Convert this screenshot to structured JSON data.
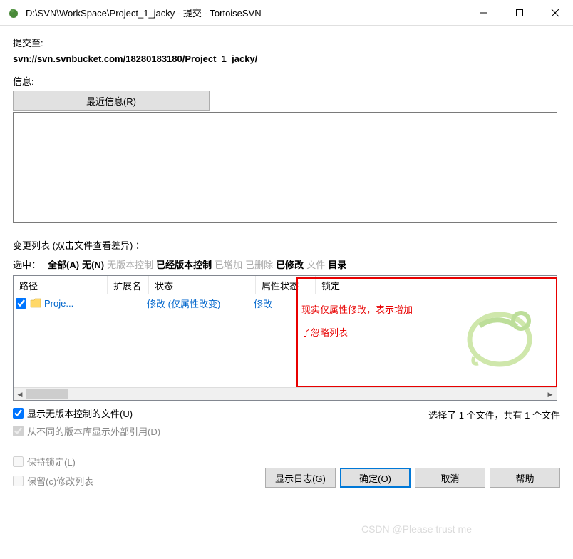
{
  "titlebar": {
    "icon": "tortoisesvn",
    "text": "D:\\SVN\\WorkSpace\\Project_1_jacky - 提交 - TortoiseSVN"
  },
  "commit_to": {
    "label": "提交至:",
    "url": "svn://svn.svnbucket.com/18280183180/Project_1_jacky/"
  },
  "info": {
    "label": "信息:",
    "recent_button": "最近信息(R)"
  },
  "changelist": {
    "label": "变更列表  (双击文件查看差异) ："
  },
  "filters": {
    "label": "选中：",
    "all": "全部(A)",
    "none": "无(N)",
    "unversioned": "无版本控制",
    "versioned": "已经版本控制",
    "added": "已增加",
    "deleted": "已删除",
    "modified": "已修改",
    "files": "文件",
    "dirs": "目录"
  },
  "table": {
    "headers": {
      "path": "路径",
      "ext": "扩展名",
      "status": "状态",
      "propstatus": "属性状态",
      "lock": "锁定"
    },
    "rows": [
      {
        "checked": true,
        "icon": "folder",
        "path": "Proje...",
        "ext": "",
        "status": "修改 (仅属性改变)",
        "propstatus": "修改",
        "lock": ""
      }
    ]
  },
  "annotation": {
    "line1": "现实仅属性修改，表示增加",
    "line2": "了忽略列表"
  },
  "options": {
    "show_unversioned": "显示无版本控制的文件(U)",
    "show_externals": "从不同的版本库显示外部引用(D)",
    "status_text": "选择了 1 个文件，共有 1 个文件"
  },
  "bottom": {
    "keep_locks": "保持锁定(L)",
    "keep_changelist": "保留(c)修改列表",
    "show_log": "显示日志(G)",
    "ok": "确定(O)",
    "cancel": "取消",
    "help": "帮助"
  },
  "csdn": "CSDN @Please trust me"
}
